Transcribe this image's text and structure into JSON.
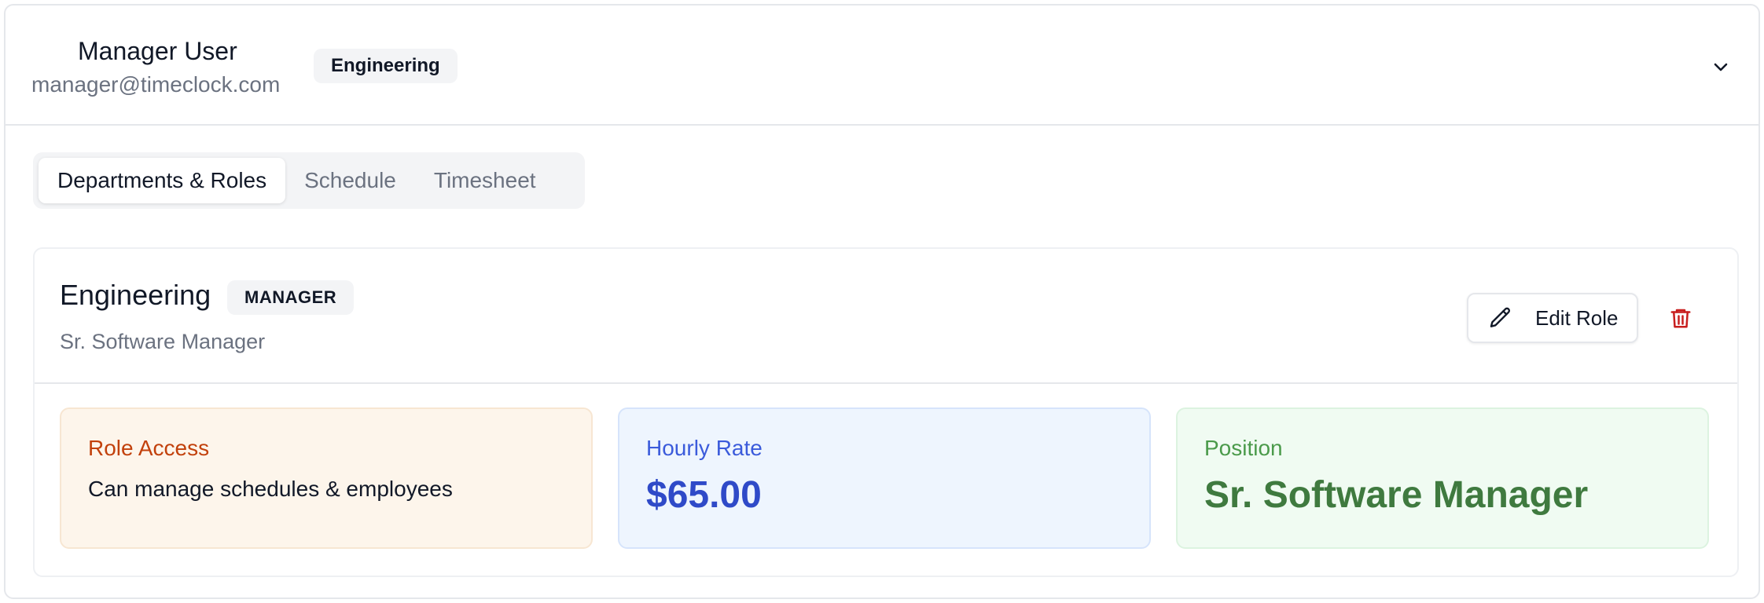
{
  "user": {
    "name": "Manager User",
    "email": "manager@timeclock.com",
    "department_badge": "Engineering"
  },
  "tabs": [
    {
      "label": "Departments & Roles",
      "active": true
    },
    {
      "label": "Schedule",
      "active": false
    },
    {
      "label": "Timesheet",
      "active": false
    }
  ],
  "role": {
    "department": "Engineering",
    "access_badge": "MANAGER",
    "title": "Sr. Software Manager",
    "edit_label": "Edit Role"
  },
  "info": {
    "role_access": {
      "label": "Role Access",
      "value": "Can manage schedules & employees"
    },
    "hourly_rate": {
      "label": "Hourly Rate",
      "value": "$65.00"
    },
    "position": {
      "label": "Position",
      "value": "Sr. Software Manager"
    }
  },
  "icons": {
    "expand": "chevron-down-icon",
    "edit": "pencil-icon",
    "delete": "trash-icon"
  },
  "colors": {
    "delete": "#c81e1e",
    "role_access_accent": "#c2410c",
    "hourly_rate_accent": "#2f4ac8",
    "position_accent": "#3f7a3f"
  }
}
